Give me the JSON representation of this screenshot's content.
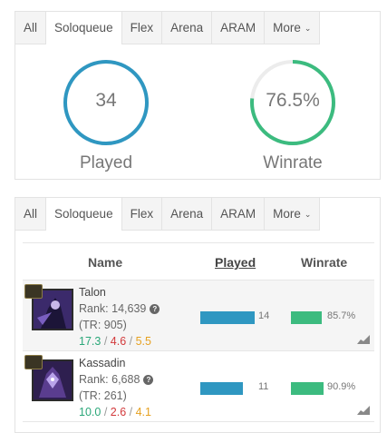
{
  "tabs": [
    {
      "label": "All",
      "active": false
    },
    {
      "label": "Soloqueue",
      "active": true
    },
    {
      "label": "Flex",
      "active": false
    },
    {
      "label": "Arena",
      "active": false
    },
    {
      "label": "ARAM",
      "active": false
    },
    {
      "label": "More",
      "active": false
    }
  ],
  "summary": {
    "played": {
      "value": "34",
      "caption": "Played",
      "color": "#2f97c1",
      "fraction": 1.0
    },
    "winrate": {
      "value": "76.5%",
      "caption": "Winrate",
      "color": "#3cbb7f",
      "fraction": 0.765
    }
  },
  "table": {
    "headers": {
      "name": "Name",
      "played": "Played",
      "winrate": "Winrate"
    },
    "rows": [
      {
        "name": "Talon",
        "rank_label": "Rank: 14,639",
        "tr": "(TR: 905)",
        "kills": "17.3",
        "deaths": "4.6",
        "assists": "5.5",
        "played": "14",
        "played_fraction": 0.412,
        "winrate": "85.7%",
        "winrate_fraction": 0.857,
        "portrait_color": "#3b2a6b"
      },
      {
        "name": "Kassadin",
        "rank_label": "Rank: 6,688",
        "tr": "(TR: 261)",
        "kills": "10.0",
        "deaths": "2.6",
        "assists": "4.1",
        "played": "11",
        "played_fraction": 0.324,
        "winrate": "90.9%",
        "winrate_fraction": 0.909,
        "portrait_color": "#5a3d8f"
      }
    ]
  },
  "colors": {
    "accent_blue": "#2f97c1",
    "accent_green": "#3cbb7f",
    "kills": "#2aa779",
    "deaths": "#d2393b",
    "assists": "#e6a121"
  }
}
